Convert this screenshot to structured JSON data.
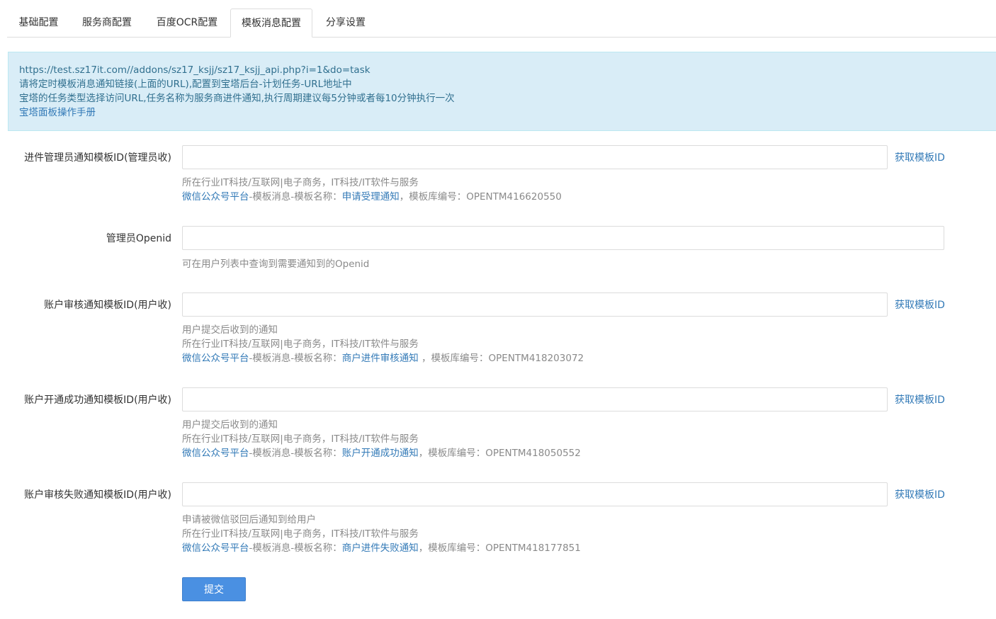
{
  "tabs": [
    {
      "label": "基础配置"
    },
    {
      "label": "服务商配置"
    },
    {
      "label": "百度OCR配置"
    },
    {
      "label": "模板消息配置",
      "active": true
    },
    {
      "label": "分享设置"
    }
  ],
  "notice": {
    "url": "https://test.sz17it.com//addons/sz17_ksjj/sz17_ksjj_api.php?i=1&do=task",
    "line1": "请将定时模板消息通知链接(上面的URL),配置到宝塔后台-计划任务-URL地址中",
    "line2": "宝塔的任务类型选择访问URL,任务名称为服务商进件通知,执行周期建议每5分钟或者每10分钟执行一次",
    "manual_link": "宝塔面板操作手册"
  },
  "fields": {
    "admin_template": {
      "label": "进件管理员通知模板ID(管理员收)",
      "value": "",
      "fetch": "获取模板ID",
      "industry": "所在行业IT科技/互联网|电子商务，IT科技/IT软件与服务",
      "platform": "微信公众号平台",
      "path": "-模板消息-模板名称：",
      "template_name": "申请受理通知",
      "code": "，模板库编号：OPENTM416620550"
    },
    "admin_openid": {
      "label": "管理员Openid",
      "value": "",
      "hint": "可在用户列表中查询到需要通知到的Openid"
    },
    "review_template": {
      "label": "账户审核通知模板ID(用户收)",
      "value": "",
      "fetch": "获取模板ID",
      "note": "用户提交后收到的通知",
      "industry": "所在行业IT科技/互联网|电子商务，IT科技/IT软件与服务",
      "platform": "微信公众号平台",
      "path": "-模板消息-模板名称：",
      "template_name": "商户进件审核通知",
      "code": " ，模板库编号：OPENTM418203072"
    },
    "success_template": {
      "label": "账户开通成功通知模板ID(用户收)",
      "value": "",
      "fetch": "获取模板ID",
      "note": "用户提交后收到的通知",
      "industry": "所在行业IT科技/互联网|电子商务，IT科技/IT软件与服务",
      "platform": "微信公众号平台",
      "path": "-模板消息-模板名称：",
      "template_name": "账户开通成功通知",
      "code": "，模板库编号：OPENTM418050552"
    },
    "fail_template": {
      "label": "账户审核失败通知模板ID(用户收)",
      "value": "",
      "fetch": "获取模板ID",
      "note": "申请被微信驳回后通知到给用户",
      "industry": "所在行业IT科技/互联网|电子商务，IT科技/IT软件与服务",
      "platform": "微信公众号平台",
      "path": "-模板消息-模板名称：",
      "template_name": "商户进件失败通知",
      "code": "，模板库编号：OPENTM418177851"
    }
  },
  "submit_label": "提交",
  "colors": {
    "link": "#337ab7",
    "notice_bg": "#d9edf7",
    "button": "#4a90e2"
  }
}
